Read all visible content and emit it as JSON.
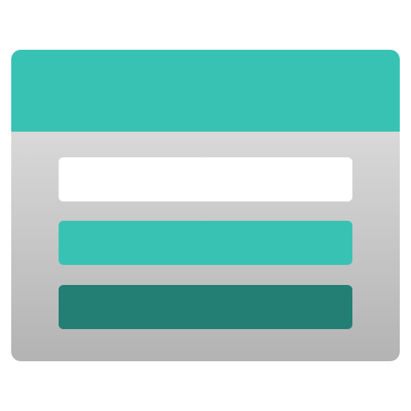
{
  "icon": {
    "name": "app-window-icon",
    "colors": {
      "titlebar": "#38c2b3",
      "row_primary": "#ffffff",
      "row_secondary": "#38c2b3",
      "row_tertiary": "#237f73",
      "body_gradient_top": "#e6e6e6",
      "body_gradient_bottom": "#b3b3b3"
    }
  }
}
